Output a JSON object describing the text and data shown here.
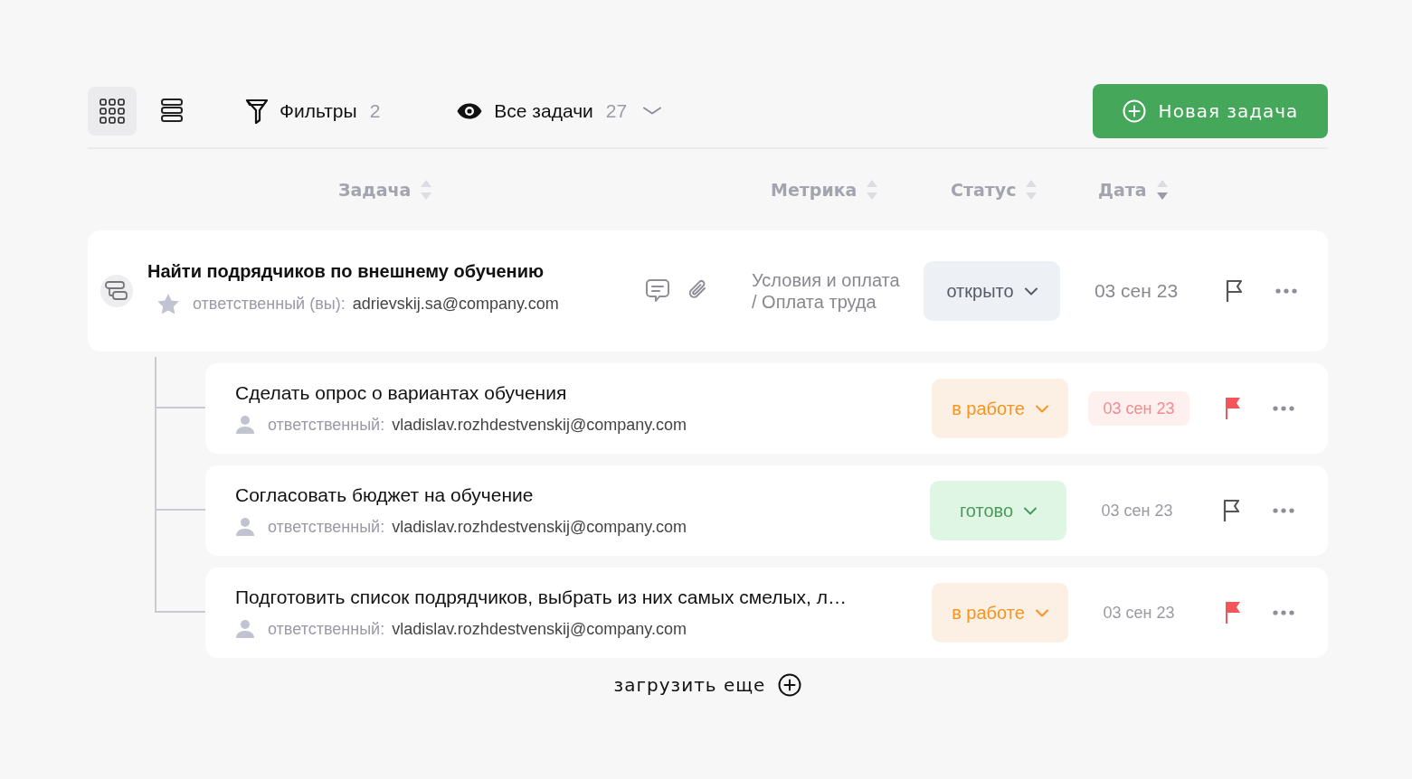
{
  "toolbar": {
    "view_modes": [
      {
        "kind": "grid",
        "selected": true
      },
      {
        "kind": "list",
        "selected": false
      }
    ],
    "filters": {
      "label": "Фильтры",
      "count": "2"
    },
    "view": {
      "label": "Все задачи",
      "count": "27"
    },
    "new_task_button": "Новая задача"
  },
  "columns": [
    {
      "label": "Задача",
      "sorted": false
    },
    {
      "label": "Метрика",
      "sorted": false
    },
    {
      "label": "Статус",
      "sorted": false
    },
    {
      "label": "Дата",
      "sorted": true
    }
  ],
  "task": {
    "title": "Найти подрядчиков по внешнему обучению",
    "starred": false,
    "assignee_label": "ответственный (вы):",
    "assignee_email": "adrievskij.sa@company.com",
    "metric": "Условия и оплата / Оплата труда",
    "status": {
      "kind": "open",
      "label": "открыто"
    },
    "date": "03 сен 23",
    "overdue": false,
    "flagged": false
  },
  "subtasks": [
    {
      "title": "Сделать опрос о вариантах обучения",
      "assignee_label": "ответственный:",
      "assignee_email": "vladislav.rozhdestvenskij@company.com",
      "status": {
        "kind": "in_progress",
        "label": "в работе"
      },
      "date": "03 сен 23",
      "overdue": true,
      "flagged": true
    },
    {
      "title": "Согласовать бюджет на обучение",
      "assignee_label": "ответственный:",
      "assignee_email": "vladislav.rozhdestvenskij@company.com",
      "status": {
        "kind": "done",
        "label": "готово"
      },
      "date": "03 сен 23",
      "overdue": false,
      "flagged": false
    },
    {
      "title": "Подготовить список подрядчиков, выбрать из них самых смелых, л…",
      "assignee_label": "ответственный:",
      "assignee_email": "vladislav.rozhdestvenskij@company.com",
      "status": {
        "kind": "in_progress",
        "label": "в работе"
      },
      "date": "03 сен 23",
      "overdue": false,
      "flagged": true
    }
  ],
  "load_more": "загрузить еще"
}
